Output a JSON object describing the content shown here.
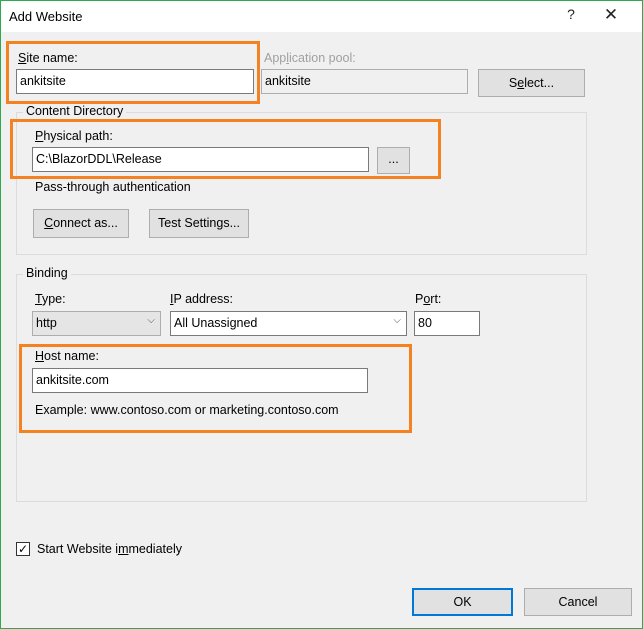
{
  "window": {
    "title": "Add Website",
    "help_glyph": "?",
    "close_glyph": "✕"
  },
  "site": {
    "label_access": "S",
    "label_rest": "ite name:",
    "value": "ankitsite"
  },
  "app_pool": {
    "label_pre": "App",
    "label_access": "l",
    "label_rest": "ication pool:",
    "value": "ankitsite",
    "select_pre": "S",
    "select_access": "e",
    "select_rest": "lect..."
  },
  "content_directory": {
    "title": "Content Directory",
    "physical_path_access": "P",
    "physical_path_rest": "hysical path:",
    "physical_path_value": "C:\\BlazorDDL\\Release",
    "browse_label": "...",
    "passthrough_label": "Pass-through authentication",
    "connect_access": "C",
    "connect_rest": "onnect as...",
    "test_pre": "Test Settin",
    "test_access": "g",
    "test_rest": "s..."
  },
  "binding": {
    "title": "Binding",
    "type_access": "T",
    "type_rest": "ype:",
    "type_value": "http",
    "ip_access": "I",
    "ip_rest": "P address:",
    "ip_value": "All Unassigned",
    "port_pre": "P",
    "port_access": "o",
    "port_rest": "rt:",
    "port_value": "80",
    "host_access": "H",
    "host_rest": "ost name:",
    "host_value": "ankitsite.com",
    "example": "Example: www.contoso.com or marketing.contoso.com",
    "chevron_glyph": "⌵"
  },
  "start_website": {
    "checked": true,
    "check_glyph": "✓",
    "label_pre": "Start Website i",
    "label_access": "m",
    "label_rest": "mediately"
  },
  "footer": {
    "ok_label": "OK",
    "cancel_label": "Cancel"
  },
  "colors": {
    "highlight": "#f58220",
    "window_border": "#2eaa4e",
    "default_button_border": "#0078d7"
  }
}
